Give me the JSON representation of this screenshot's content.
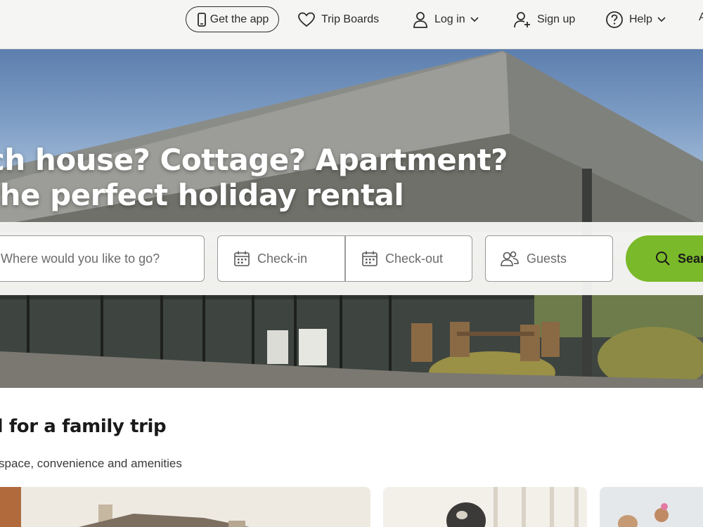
{
  "header": {
    "get_app": "Get the app",
    "trip_boards": "Trip Boards",
    "log_in": "Log in",
    "sign_up": "Sign up",
    "help": "Help",
    "edge_fragment": "A"
  },
  "hero": {
    "title_line1": "ch house? Cottage? Apartment?",
    "title_line2": "the perfect holiday rental"
  },
  "search": {
    "destination_placeholder": "Where would you like to go?",
    "checkin_placeholder": "Check-in",
    "checkout_placeholder": "Check-out",
    "guests_placeholder": "Guests",
    "search_label": "Sear"
  },
  "family": {
    "title": "d for a family trip",
    "subtitle": "space, convenience and amenities"
  },
  "colors": {
    "accent_green": "#7ab929",
    "header_bg": "#f5f5f3"
  },
  "icons": [
    "phone-icon",
    "heart-icon",
    "user-icon",
    "user-plus-icon",
    "help-icon",
    "chevron-down-icon",
    "calendar-icon",
    "guests-icon",
    "search-icon"
  ]
}
